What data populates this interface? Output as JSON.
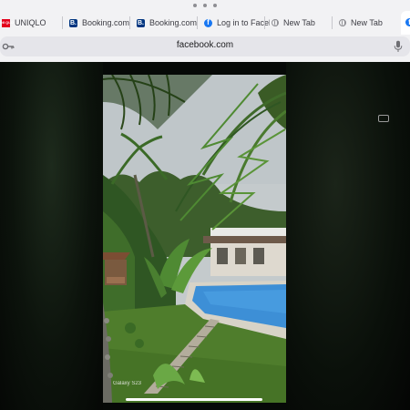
{
  "browser": {
    "more_menu_icon": "ellipsis-icon",
    "tabs": [
      {
        "label": "UNIQLO",
        "favicon": "uniqlo-logo-icon",
        "favicon_text": "UNI QLO"
      },
      {
        "label": "Booking.com",
        "favicon": "booking-icon",
        "favicon_text": "B."
      },
      {
        "label": "Booking.com",
        "favicon": "booking-icon",
        "favicon_text": "B."
      },
      {
        "label": "Log in to Facebook",
        "favicon": "facebook-icon",
        "favicon_text": "f"
      },
      {
        "label": "New Tab",
        "favicon": "globe-icon",
        "favicon_text": ""
      },
      {
        "label": "New Tab",
        "favicon": "globe-icon",
        "favicon_text": ""
      }
    ],
    "active_tab_favicon": "facebook-icon",
    "address_bar": {
      "url": "facebook.com",
      "left_icon": "key-icon",
      "right_icon": "microphone-icon"
    }
  },
  "content": {
    "video_watermark": "Galaxy S23",
    "colors": {
      "sky": "#c4cacc",
      "foliage": "#3f6a2a",
      "pool": "#3d8fd6",
      "lawn": "#4f7d2c"
    }
  }
}
